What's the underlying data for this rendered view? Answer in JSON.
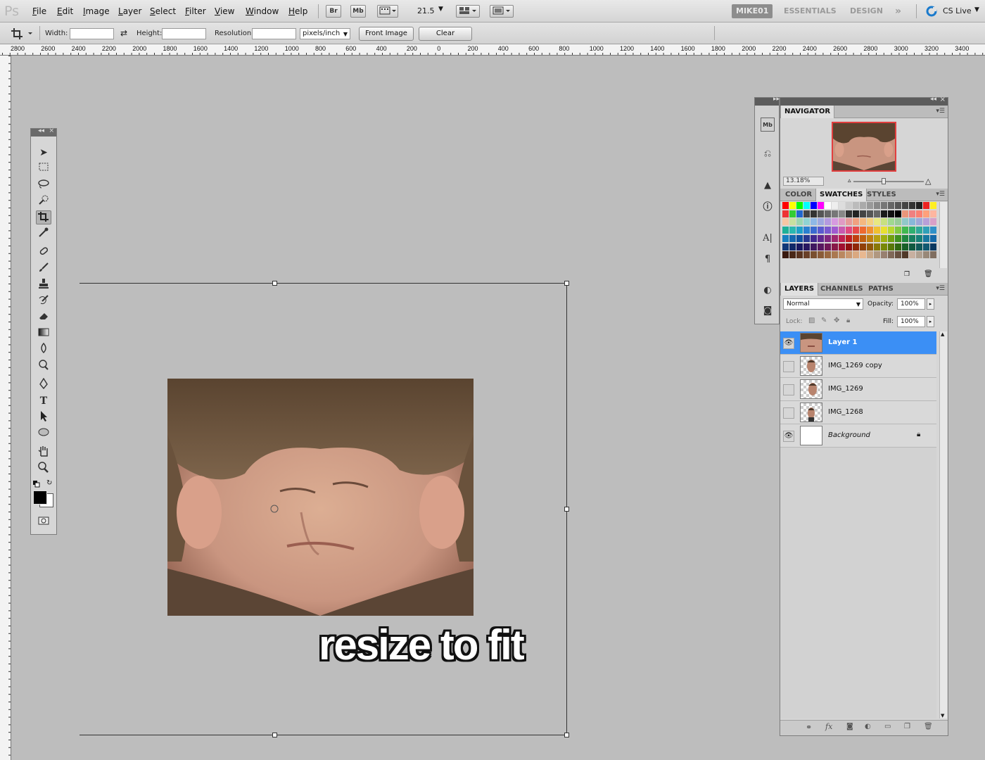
{
  "app": {
    "logo": "Ps"
  },
  "menu": [
    "File",
    "Edit",
    "Image",
    "Layer",
    "Select",
    "Filter",
    "View",
    "Window",
    "Help"
  ],
  "menubar_buttons": {
    "bridge": "Br",
    "mini_bridge": "Mb",
    "zoom": "21.5"
  },
  "workspaces": {
    "active": "MIKE01",
    "items": [
      "ESSENTIALS",
      "DESIGN"
    ],
    "more": "»",
    "cs_live": "CS Live"
  },
  "options": {
    "width_label": "Width:",
    "height_label": "Height:",
    "resolution_label": "Resolution:",
    "width_value": "",
    "height_value": "",
    "resolution_value": "",
    "unit": "pixels/inch",
    "front_image": "Front Image",
    "clear": "Clear"
  },
  "ruler_labels": [
    "2800",
    "2600",
    "2400",
    "2200",
    "2000",
    "1800",
    "1600",
    "1400",
    "1200",
    "1000",
    "800",
    "600",
    "400",
    "200",
    "0",
    "200",
    "400",
    "600",
    "800",
    "1000",
    "1200",
    "1400",
    "1600",
    "1800",
    "2000",
    "2200",
    "2400",
    "2600",
    "2800",
    "3000",
    "3200",
    "3400",
    "36"
  ],
  "caption": "resize to fit",
  "navigator": {
    "tab": "NAVIGATOR",
    "zoom": "13.18%"
  },
  "color_panel": {
    "tabs": [
      "COLOR",
      "SWATCHES",
      "STYLES"
    ],
    "active": "SWATCHES"
  },
  "swatch_colors": [
    [
      "#ff0000",
      "#ffff00",
      "#00ff00",
      "#00ffff",
      "#0000ff",
      "#ff00ff",
      "#ffffff",
      "#eeeeee",
      "#dddddd",
      "#cccccc",
      "#bbbbbb",
      "#aaaaaa",
      "#999999",
      "#888888",
      "#777777",
      "#666666",
      "#555555",
      "#444444",
      "#333333",
      "#222222",
      "#ee2222",
      "#ffee22"
    ],
    [
      "#ee3333",
      "#33cc33",
      "#2266cc",
      "#444444",
      "#333333",
      "#555555",
      "#666666",
      "#777777",
      "#888888",
      "#333333",
      "#222222",
      "#444444",
      "#555555",
      "#666666",
      "#1a1a1a",
      "#111111",
      "#000000",
      "#e9967a",
      "#f08080",
      "#fa8072",
      "#ffa07a",
      "#ffb6a0"
    ],
    [
      "#f7c6a3",
      "#c7e0a0",
      "#9cd6b0",
      "#8fd3d3",
      "#8fb8e6",
      "#9fa8e0",
      "#b49ae0",
      "#d69ae0",
      "#e09ac4",
      "#e69a9a",
      "#f0a080",
      "#f4b880",
      "#f4d080",
      "#e8e880",
      "#c8e080",
      "#a0d890",
      "#98cc98",
      "#90c8c8",
      "#88b8d8",
      "#a0a8d8",
      "#b8a0d8",
      "#d8a0c8"
    ],
    [
      "#1eb098",
      "#2ab8b0",
      "#1ea0c8",
      "#2a80d0",
      "#3a6ad0",
      "#5a5ad0",
      "#7a5ad0",
      "#a05ad0",
      "#c85ab0",
      "#e04a80",
      "#e84a4a",
      "#ee6a30",
      "#f09030",
      "#f0c030",
      "#e8e030",
      "#b8d830",
      "#80c840",
      "#40b850",
      "#30b070",
      "#30a898",
      "#30a0b8",
      "#3090c8"
    ],
    [
      "#1880c0",
      "#1468b0",
      "#1050a0",
      "#283890",
      "#402890",
      "#602890",
      "#802880",
      "#a02870",
      "#c02050",
      "#c02020",
      "#c04010",
      "#c06010",
      "#c08010",
      "#b8a010",
      "#a0b010",
      "#70a010",
      "#409020",
      "#208840",
      "#188060",
      "#188078",
      "#1878a0",
      "#1468a8"
    ],
    [
      "#103878",
      "#102868",
      "#181860",
      "#281860",
      "#401860",
      "#581860",
      "#701858",
      "#881848",
      "#a01030",
      "#901010",
      "#902808",
      "#904008",
      "#905808",
      "#887808",
      "#788808",
      "#587808",
      "#306810",
      "#186028",
      "#105840",
      "#105858",
      "#105870",
      "#0a3860"
    ],
    [
      "#3a1a10",
      "#4a2818",
      "#5a3420",
      "#6a4028",
      "#7a5030",
      "#8a5c38",
      "#9a6840",
      "#aa7850",
      "#ba8860",
      "#ca9870",
      "#daa880",
      "#e8b890",
      "#c8a888",
      "#b09880",
      "#988070",
      "#806858",
      "#685040",
      "#503828",
      "#c8b0a0",
      "#b0a090",
      "#988878",
      "#806e60"
    ]
  ],
  "layers_panel": {
    "tabs": [
      "LAYERS",
      "CHANNELS",
      "PATHS"
    ],
    "blend_mode": "Normal",
    "opacity_label": "Opacity:",
    "opacity": "100%",
    "lock_label": "Lock:",
    "fill_label": "Fill:",
    "fill": "100%",
    "layers": [
      {
        "name": "Layer 1",
        "visible": true,
        "selected": true
      },
      {
        "name": "IMG_1269 copy",
        "visible": false,
        "selected": false
      },
      {
        "name": "IMG_1269",
        "visible": false,
        "selected": false
      },
      {
        "name": "IMG_1268",
        "visible": false,
        "selected": false
      },
      {
        "name": "Background",
        "visible": true,
        "selected": false,
        "locked": true
      }
    ]
  },
  "colors": {
    "accent": "#3b8ff5",
    "canvas_bg": "#bdbdbd",
    "nav_frame": "#e23e3e"
  }
}
